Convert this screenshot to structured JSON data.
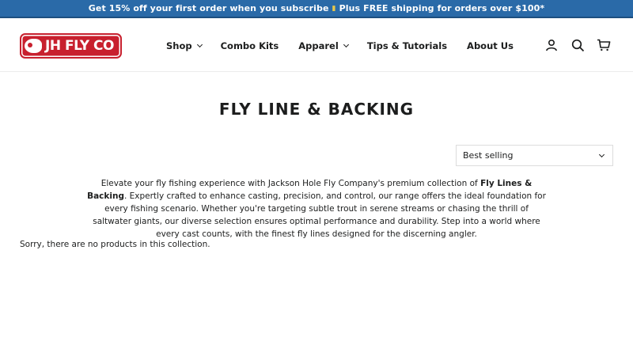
{
  "announcement": {
    "part1": "Get 15% off your first order when you subscribe",
    "tag": "▮",
    "part2": "Plus FREE shipping for orders over $100*"
  },
  "logo": {
    "text": "JH FLY CO"
  },
  "nav": {
    "items": [
      {
        "label": "Shop",
        "has_dropdown": true
      },
      {
        "label": "Combo Kits",
        "has_dropdown": false
      },
      {
        "label": "Apparel",
        "has_dropdown": true
      },
      {
        "label": "Tips & Tutorials",
        "has_dropdown": false
      },
      {
        "label": "About Us",
        "has_dropdown": false
      }
    ]
  },
  "header_icons": [
    "account-icon",
    "search-icon",
    "cart-icon"
  ],
  "page": {
    "title": "FLY LINE & BACKING",
    "sort_selected": "Best selling",
    "description_before": "Elevate your fly fishing experience with Jackson Hole Fly Company's premium collection of ",
    "description_bold": "Fly Lines & Backing",
    "description_after": ". Expertly crafted to enhance casting, precision, and control, our range offers the ideal foundation for every fishing scenario. Whether you're targeting subtle trout in serene streams or chasing the thrill of saltwater giants, our diverse selection ensures optimal performance and durability. Step into a world where every cast counts, with the finest fly lines designed for the discerning angler.",
    "empty_message": "Sorry, there are no products in this collection."
  },
  "colors": {
    "announcement_bg": "#2a6aa8",
    "logo_red": "#c8202e",
    "text": "#1c1d1d"
  }
}
